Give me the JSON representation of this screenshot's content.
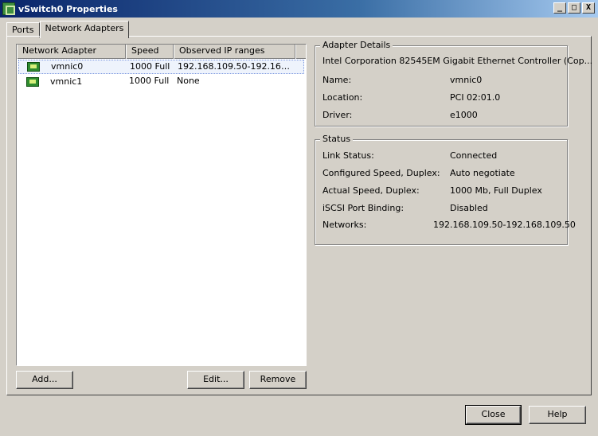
{
  "window": {
    "title": "vSwitch0 Properties",
    "buttons": {
      "min": "_",
      "max": "□",
      "close": "X"
    }
  },
  "tabs": [
    {
      "label": "Ports"
    },
    {
      "label": "Network Adapters"
    }
  ],
  "table": {
    "headers": [
      "Network Adapter",
      "Speed",
      "Observed IP ranges"
    ],
    "rows": [
      {
        "name": "vmnic0",
        "speed": "1000 Full",
        "ip": "192.168.109.50-192.168.1...",
        "selected": true
      },
      {
        "name": "vmnic1",
        "speed": "1000 Full",
        "ip": "None",
        "selected": false
      }
    ]
  },
  "buttons": {
    "add": "Add...",
    "edit": "Edit...",
    "remove": "Remove",
    "close": "Close",
    "help": "Help"
  },
  "adapter_details": {
    "legend": "Adapter Details",
    "description": "Intel Corporation 82545EM Gigabit Ethernet Controller (Cop...",
    "fields": [
      {
        "label": "Name:",
        "value": "vmnic0"
      },
      {
        "label": "Location:",
        "value": "PCI 02:01.0"
      },
      {
        "label": "Driver:",
        "value": "e1000"
      }
    ]
  },
  "status": {
    "legend": "Status",
    "fields": [
      {
        "label": "Link Status:",
        "value": "Connected"
      },
      {
        "label": "Configured Speed, Duplex:",
        "value": "Auto negotiate"
      },
      {
        "label": "Actual Speed, Duplex:",
        "value": "1000 Mb, Full Duplex"
      },
      {
        "label": "iSCSI Port Binding:",
        "value": "Disabled"
      },
      {
        "label": "Networks:",
        "value": "192.168.109.50-192.168.109.50"
      }
    ]
  },
  "icons": {
    "window": "vswitch-icon",
    "adapter": "network-card-icon"
  }
}
